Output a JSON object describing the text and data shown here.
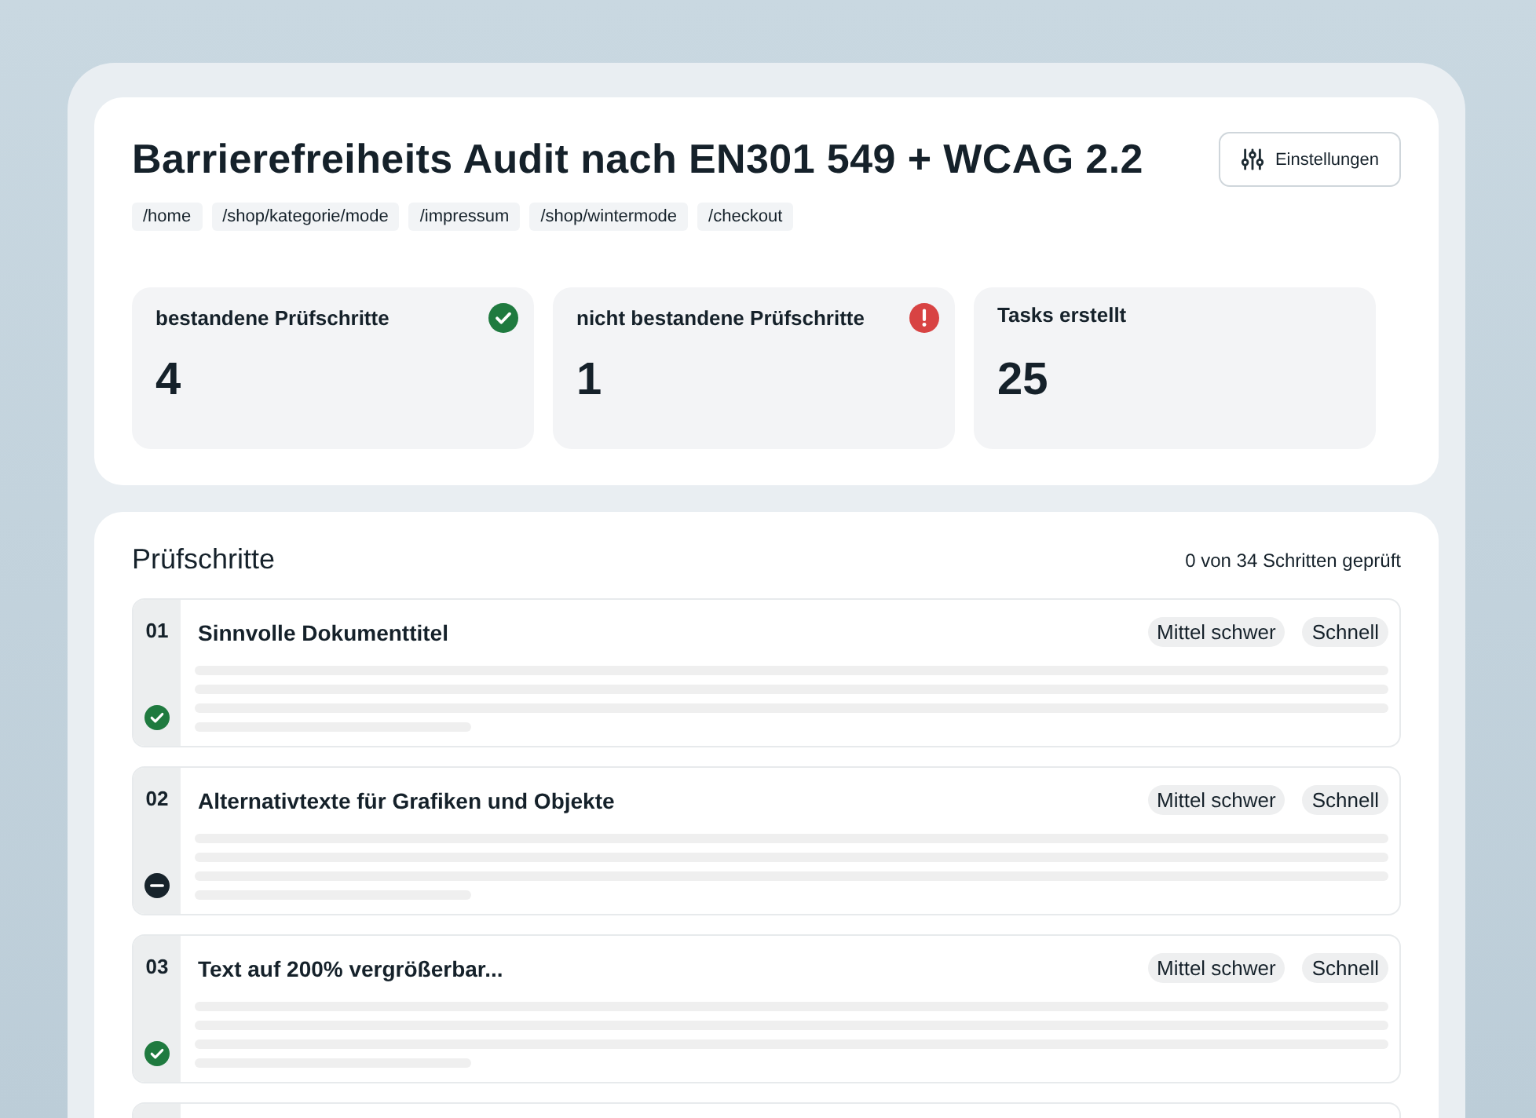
{
  "header": {
    "title": "Barrierefreiheits Audit nach EN301 549 + WCAG 2.2",
    "settings_button": "Einstellungen",
    "paths": [
      "/home",
      "/shop/kategorie/mode",
      "/impressum",
      "/shop/wintermode",
      "/checkout"
    ]
  },
  "stats": [
    {
      "label": "bestandene Prüfschritte",
      "value": "4",
      "kind": "passed"
    },
    {
      "label": "nicht bestandene Prüfschritte",
      "value": "1",
      "kind": "failed"
    },
    {
      "label": "Tasks erstellt",
      "value": "25",
      "kind": "plain"
    }
  ],
  "steps_section": {
    "title": "Prüfschritte",
    "progress": "0 von 34 Schritten geprüft",
    "steps": [
      {
        "number": "01",
        "title": "Sinnvolle Dokumenttitel",
        "tags": [
          "Mittel schwer",
          "Schnell"
        ],
        "passed": true
      },
      {
        "number": "02",
        "title": "Alternativtexte für Grafiken und Objekte",
        "tags": [
          "Mittel schwer",
          "Schnell"
        ],
        "passed": false
      },
      {
        "number": "03",
        "title": "Text auf 200% vergrößerbar...",
        "tags": [
          "Mittel schwer",
          "Schnell"
        ],
        "passed": true
      }
    ]
  }
}
